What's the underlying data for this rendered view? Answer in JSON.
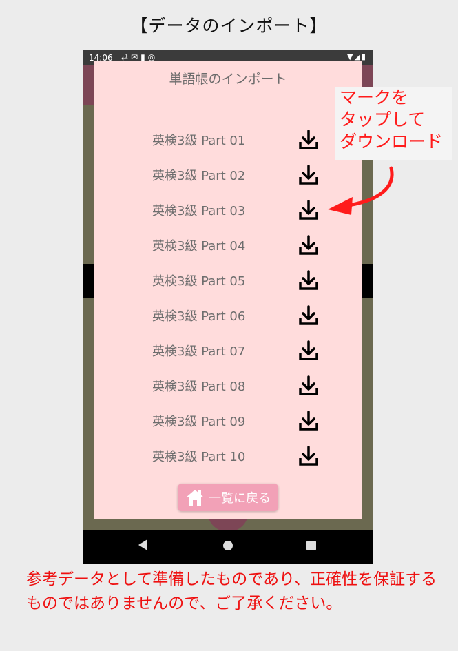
{
  "page_title": "【データのインポート】",
  "status_bar": {
    "time": "14:06"
  },
  "dialog": {
    "title": "単語帳のインポート",
    "items": [
      {
        "label": "英検3級 Part 01"
      },
      {
        "label": "英検3級 Part 02"
      },
      {
        "label": "英検3級 Part 03"
      },
      {
        "label": "英検3級 Part 04"
      },
      {
        "label": "英検3級 Part 05"
      },
      {
        "label": "英検3級 Part 06"
      },
      {
        "label": "英検3級 Part 07"
      },
      {
        "label": "英検3級 Part 08"
      },
      {
        "label": "英検3級 Part 09"
      },
      {
        "label": "英検3級 Part 10"
      }
    ],
    "download_icon": "download-icon",
    "back_button_label": "一覧に戻る",
    "back_button_icon": "home-icon"
  },
  "callout": {
    "lines": [
      "マークを",
      "タップして",
      "ダウンロード"
    ]
  },
  "note": "参考データとして準備したものであり、正確性を保証するものではありませんので、ご了承ください。",
  "colors": {
    "dialog_bg": "#ffdcdc",
    "button_bg": "#f2a1b7",
    "annotation": "#ff1b1b",
    "app_accent": "#7d4656"
  }
}
